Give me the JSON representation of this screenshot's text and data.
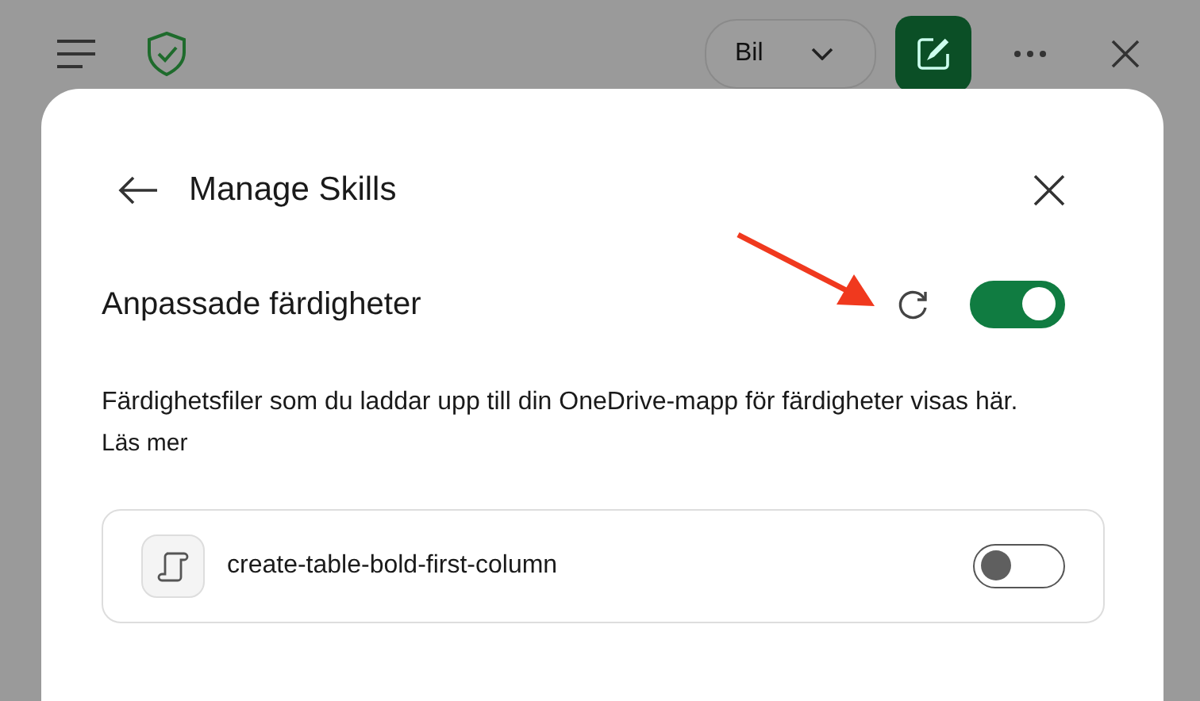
{
  "top_bar": {
    "dropdown": {
      "value": "Bil"
    }
  },
  "dialog": {
    "title": "Manage Skills",
    "section": {
      "label": "Anpassade färdigheter",
      "enabled": true
    },
    "description": "Färdighetsfiler som du laddar upp till din OneDrive-mapp för färdigheter visas här.",
    "link": "Läs mer",
    "skills": [
      {
        "name": "create-table-bold-first-column",
        "enabled": false
      }
    ]
  }
}
